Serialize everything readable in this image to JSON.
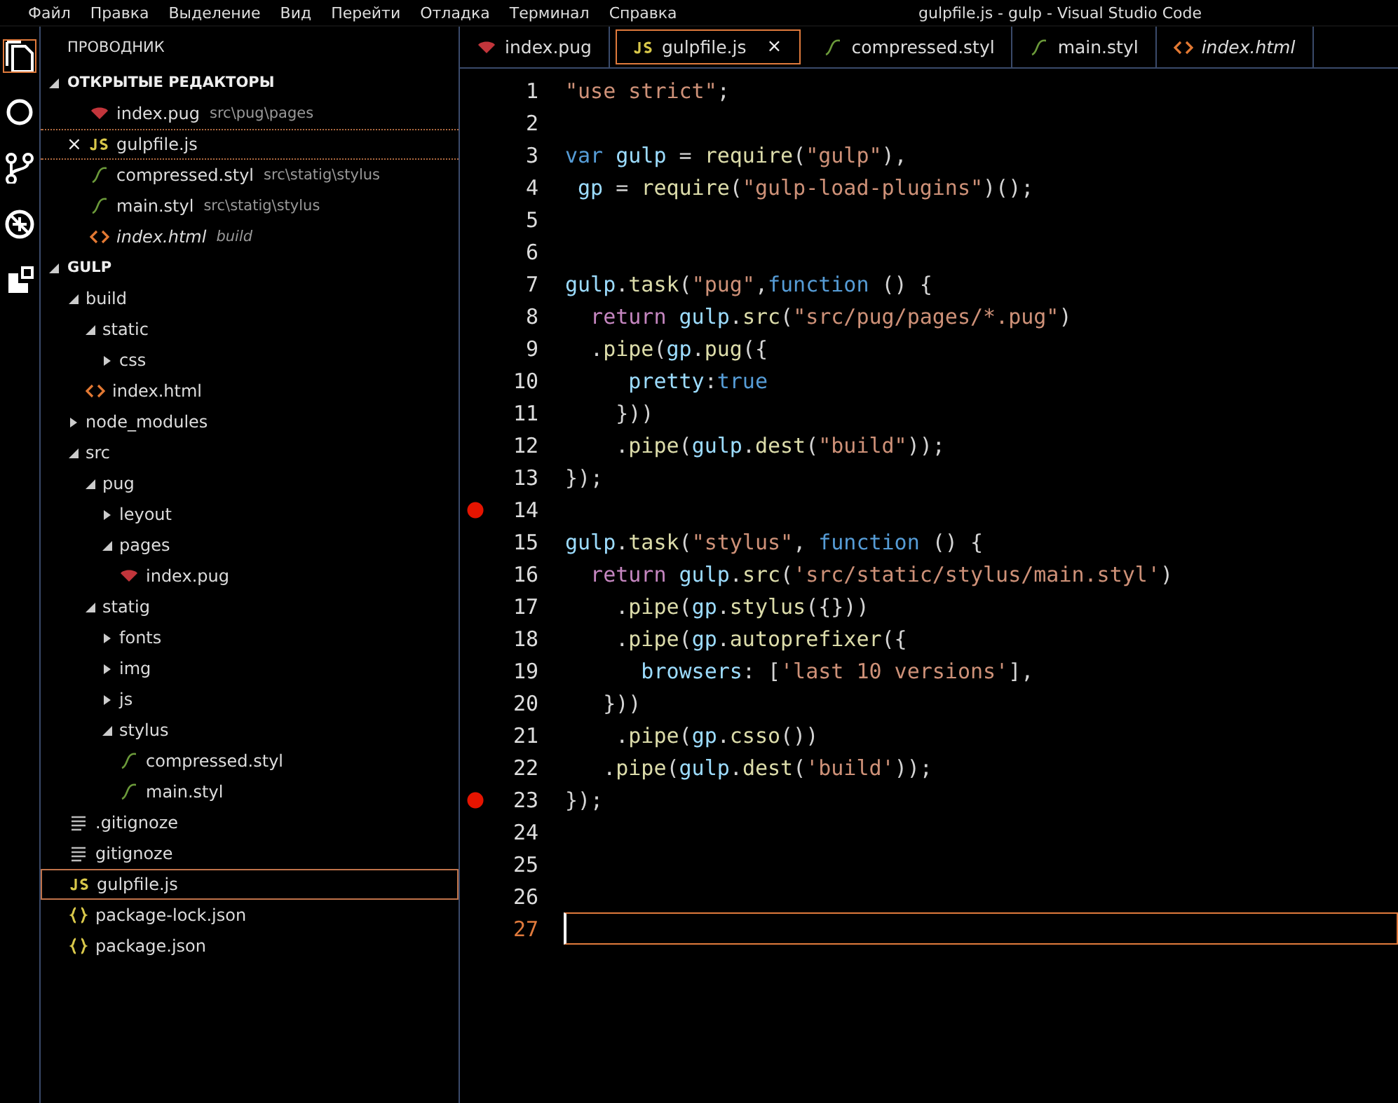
{
  "menu_bar": {
    "items": [
      "Файл",
      "Правка",
      "Выделение",
      "Вид",
      "Перейти",
      "Отладка",
      "Терминал",
      "Справка"
    ],
    "title": "gulpfile.js - gulp - Visual Studio Code"
  },
  "activity_bar": [
    {
      "kind": "files",
      "selected": true
    },
    {
      "kind": "search",
      "selected": false
    },
    {
      "kind": "git",
      "selected": false
    },
    {
      "kind": "debug",
      "selected": false
    },
    {
      "kind": "extensions",
      "selected": false
    }
  ],
  "sidebar": {
    "title": "ПРОВОДНИК",
    "open_editors": {
      "title": "ОТКРЫТЫЕ РЕДАКТОРЫ",
      "expanded": true,
      "items": [
        {
          "name": "index.pug",
          "path": "src\\pug\\pages",
          "kind": "pug",
          "selected": false,
          "preview": false
        },
        {
          "name": "gulpfile.js",
          "kind": "js",
          "selected": true,
          "preview": false,
          "close": "×"
        },
        {
          "name": "compressed.styl",
          "path": "src\\statig\\stylus",
          "kind": "styl",
          "selected": false,
          "preview": false
        },
        {
          "name": "main.styl",
          "path": "src\\statig\\stylus",
          "kind": "styl",
          "selected": false,
          "preview": false
        },
        {
          "name": "index.html",
          "path": "build",
          "kind": "html",
          "selected": false,
          "preview": true
        }
      ]
    },
    "workspace": {
      "title": "GULP",
      "expanded": true,
      "tree": [
        {
          "name": "build",
          "kind": "folder",
          "expanded": true,
          "selected": false,
          "children": [
            {
              "name": "static",
              "kind": "folder",
              "expanded": true,
              "selected": false,
              "children": [
                {
                  "name": "css",
                  "kind": "folder",
                  "expanded": false,
                  "selected": false
                }
              ]
            },
            {
              "name": "index.html",
              "kind": "html",
              "selected": false
            }
          ]
        },
        {
          "name": "node_modules",
          "kind": "folder",
          "expanded": false,
          "selected": false
        },
        {
          "name": "src",
          "kind": "folder",
          "expanded": true,
          "selected": false,
          "children": [
            {
              "name": "pug",
              "kind": "folder",
              "expanded": true,
              "selected": false,
              "children": [
                {
                  "name": "leyout",
                  "kind": "folder",
                  "expanded": false,
                  "selected": false
                },
                {
                  "name": "pages",
                  "kind": "folder",
                  "expanded": true,
                  "selected": false,
                  "children": [
                    {
                      "name": "index.pug",
                      "kind": "pug",
                      "selected": false
                    }
                  ]
                }
              ]
            },
            {
              "name": "statig",
              "kind": "folder",
              "expanded": true,
              "selected": false,
              "children": [
                {
                  "name": "fonts",
                  "kind": "folder",
                  "expanded": false,
                  "selected": false
                },
                {
                  "name": "img",
                  "kind": "folder",
                  "expanded": false,
                  "selected": false
                },
                {
                  "name": "js",
                  "kind": "folder",
                  "expanded": false,
                  "selected": false
                },
                {
                  "name": "stylus",
                  "kind": "folder",
                  "expanded": true,
                  "selected": false,
                  "children": [
                    {
                      "name": "compressed.styl",
                      "kind": "styl",
                      "selected": false
                    },
                    {
                      "name": "main.styl",
                      "kind": "styl",
                      "selected": false
                    }
                  ]
                }
              ]
            }
          ]
        },
        {
          "name": ".gitignoze",
          "kind": "text",
          "selected": false
        },
        {
          "name": "gitignoze",
          "kind": "text",
          "selected": false
        },
        {
          "name": "gulpfile.js",
          "kind": "js",
          "selected": true
        },
        {
          "name": "package-lock.json",
          "kind": "json",
          "selected": false
        },
        {
          "name": "package.json",
          "kind": "json",
          "selected": false
        }
      ]
    }
  },
  "tabs": [
    {
      "label": "index.pug",
      "kind": "pug",
      "selected": false,
      "preview": false
    },
    {
      "label": "gulpfile.js",
      "kind": "js",
      "selected": true,
      "preview": false,
      "close": "×"
    },
    {
      "label": "compressed.styl",
      "kind": "styl",
      "selected": false,
      "preview": false
    },
    {
      "label": "main.styl",
      "kind": "styl",
      "selected": false,
      "preview": false
    },
    {
      "label": "index.html",
      "kind": "html",
      "selected": false,
      "preview": true
    }
  ],
  "editor": {
    "lines": [
      {
        "number": "1",
        "breakpoint": false,
        "current": false,
        "tokens": [
          {
            "text": "\"use strict\"",
            "kind": "str"
          },
          {
            "text": ";",
            "kind": "p"
          }
        ]
      },
      {
        "number": "2",
        "breakpoint": false,
        "current": false
      },
      {
        "number": "3",
        "breakpoint": false,
        "current": false,
        "tokens": [
          {
            "text": "var",
            "kind": "kw"
          },
          {
            "text": " gulp",
            "kind": "var"
          },
          {
            "text": " = ",
            "kind": "p"
          },
          {
            "text": "require",
            "kind": "fn"
          },
          {
            "text": "(",
            "kind": "p"
          },
          {
            "text": "\"gulp\"",
            "kind": "str"
          },
          {
            "text": "),",
            "kind": "p"
          }
        ]
      },
      {
        "number": "4",
        "breakpoint": false,
        "current": false,
        "tokens": [
          {
            "text": " gp",
            "kind": "var"
          },
          {
            "text": " = ",
            "kind": "p"
          },
          {
            "text": "require",
            "kind": "fn"
          },
          {
            "text": "(",
            "kind": "p"
          },
          {
            "text": "\"gulp-load-plugins\"",
            "kind": "str"
          },
          {
            "text": ")();",
            "kind": "p"
          }
        ]
      },
      {
        "number": "5",
        "breakpoint": false,
        "current": false
      },
      {
        "number": "6",
        "breakpoint": false,
        "current": false
      },
      {
        "number": "7",
        "breakpoint": false,
        "current": false,
        "tokens": [
          {
            "text": "gulp",
            "kind": "var"
          },
          {
            "text": ".",
            "kind": "p"
          },
          {
            "text": "task",
            "kind": "fn"
          },
          {
            "text": "(",
            "kind": "p"
          },
          {
            "text": "\"pug\"",
            "kind": "str"
          },
          {
            "text": ",",
            "kind": "p"
          },
          {
            "text": "function",
            "kind": "kw"
          },
          {
            "text": " () {",
            "kind": "p"
          }
        ]
      },
      {
        "number": "8",
        "breakpoint": false,
        "current": false,
        "tokens": [
          {
            "text": "  return",
            "kind": "ctl"
          },
          {
            "text": " gulp",
            "kind": "var"
          },
          {
            "text": ".",
            "kind": "p"
          },
          {
            "text": "src",
            "kind": "fn"
          },
          {
            "text": "(",
            "kind": "p"
          },
          {
            "text": "\"src/pug/pages/*.pug\"",
            "kind": "str"
          },
          {
            "text": ")",
            "kind": "p"
          }
        ]
      },
      {
        "number": "9",
        "breakpoint": false,
        "current": false,
        "tokens": [
          {
            "text": "  .",
            "kind": "p"
          },
          {
            "text": "pipe",
            "kind": "fn"
          },
          {
            "text": "(",
            "kind": "p"
          },
          {
            "text": "gp",
            "kind": "var"
          },
          {
            "text": ".",
            "kind": "p"
          },
          {
            "text": "pug",
            "kind": "fn"
          },
          {
            "text": "({",
            "kind": "p"
          }
        ]
      },
      {
        "number": "10",
        "breakpoint": false,
        "current": false,
        "tokens": [
          {
            "text": "     pretty",
            "kind": "var"
          },
          {
            "text": ":",
            "kind": "p"
          },
          {
            "text": "true",
            "kind": "kw"
          }
        ]
      },
      {
        "number": "11",
        "breakpoint": false,
        "current": false,
        "tokens": [
          {
            "text": "    }))",
            "kind": "p"
          }
        ]
      },
      {
        "number": "12",
        "breakpoint": false,
        "current": false,
        "tokens": [
          {
            "text": "    .",
            "kind": "p"
          },
          {
            "text": "pipe",
            "kind": "fn"
          },
          {
            "text": "(",
            "kind": "p"
          },
          {
            "text": "gulp",
            "kind": "var"
          },
          {
            "text": ".",
            "kind": "p"
          },
          {
            "text": "dest",
            "kind": "fn"
          },
          {
            "text": "(",
            "kind": "p"
          },
          {
            "text": "\"build\"",
            "kind": "str"
          },
          {
            "text": "));",
            "kind": "p"
          }
        ]
      },
      {
        "number": "13",
        "breakpoint": false,
        "current": false,
        "tokens": [
          {
            "text": "});",
            "kind": "p"
          }
        ]
      },
      {
        "number": "14",
        "breakpoint": true,
        "current": false
      },
      {
        "number": "15",
        "breakpoint": false,
        "current": false,
        "tokens": [
          {
            "text": "gulp",
            "kind": "var"
          },
          {
            "text": ".",
            "kind": "p"
          },
          {
            "text": "task",
            "kind": "fn"
          },
          {
            "text": "(",
            "kind": "p"
          },
          {
            "text": "\"stylus\"",
            "kind": "str"
          },
          {
            "text": ", ",
            "kind": "p"
          },
          {
            "text": "function",
            "kind": "kw"
          },
          {
            "text": " () {",
            "kind": "p"
          }
        ]
      },
      {
        "number": "16",
        "breakpoint": false,
        "current": false,
        "tokens": [
          {
            "text": "  return",
            "kind": "ctl"
          },
          {
            "text": " gulp",
            "kind": "var"
          },
          {
            "text": ".",
            "kind": "p"
          },
          {
            "text": "src",
            "kind": "fn"
          },
          {
            "text": "(",
            "kind": "p"
          },
          {
            "text": "'src/static/stylus/main.styl'",
            "kind": "str"
          },
          {
            "text": ")",
            "kind": "p"
          }
        ]
      },
      {
        "number": "17",
        "breakpoint": false,
        "current": false,
        "tokens": [
          {
            "text": "    .",
            "kind": "p"
          },
          {
            "text": "pipe",
            "kind": "fn"
          },
          {
            "text": "(",
            "kind": "p"
          },
          {
            "text": "gp",
            "kind": "var"
          },
          {
            "text": ".",
            "kind": "p"
          },
          {
            "text": "stylus",
            "kind": "fn"
          },
          {
            "text": "({}))",
            "kind": "p"
          }
        ]
      },
      {
        "number": "18",
        "breakpoint": false,
        "current": false,
        "tokens": [
          {
            "text": "    .",
            "kind": "p"
          },
          {
            "text": "pipe",
            "kind": "fn"
          },
          {
            "text": "(",
            "kind": "p"
          },
          {
            "text": "gp",
            "kind": "var"
          },
          {
            "text": ".",
            "kind": "p"
          },
          {
            "text": "autoprefixer",
            "kind": "fn"
          },
          {
            "text": "({",
            "kind": "p"
          }
        ]
      },
      {
        "number": "19",
        "breakpoint": false,
        "current": false,
        "tokens": [
          {
            "text": "      browsers",
            "kind": "var"
          },
          {
            "text": ": [",
            "kind": "p"
          },
          {
            "text": "'last 10 versions'",
            "kind": "str"
          },
          {
            "text": "],",
            "kind": "p"
          }
        ]
      },
      {
        "number": "20",
        "breakpoint": false,
        "current": false,
        "tokens": [
          {
            "text": "   }))",
            "kind": "p"
          }
        ]
      },
      {
        "number": "21",
        "breakpoint": false,
        "current": false,
        "tokens": [
          {
            "text": "    .",
            "kind": "p"
          },
          {
            "text": "pipe",
            "kind": "fn"
          },
          {
            "text": "(",
            "kind": "p"
          },
          {
            "text": "gp",
            "kind": "var"
          },
          {
            "text": ".",
            "kind": "p"
          },
          {
            "text": "csso",
            "kind": "fn"
          },
          {
            "text": "())",
            "kind": "p"
          }
        ]
      },
      {
        "number": "22",
        "breakpoint": false,
        "current": false,
        "tokens": [
          {
            "text": "   .",
            "kind": "p"
          },
          {
            "text": "pipe",
            "kind": "fn"
          },
          {
            "text": "(",
            "kind": "p"
          },
          {
            "text": "gulp",
            "kind": "var"
          },
          {
            "text": ".",
            "kind": "p"
          },
          {
            "text": "dest",
            "kind": "fn"
          },
          {
            "text": "(",
            "kind": "p"
          },
          {
            "text": "'build'",
            "kind": "str"
          },
          {
            "text": "));",
            "kind": "p"
          }
        ]
      },
      {
        "number": "23",
        "breakpoint": true,
        "current": false,
        "tokens": [
          {
            "text": "});",
            "kind": "p"
          }
        ]
      },
      {
        "number": "24",
        "breakpoint": false,
        "current": false
      },
      {
        "number": "25",
        "breakpoint": false,
        "current": false
      },
      {
        "number": "26",
        "breakpoint": false,
        "current": false
      },
      {
        "number": "27",
        "breakpoint": false,
        "current": true
      }
    ]
  }
}
